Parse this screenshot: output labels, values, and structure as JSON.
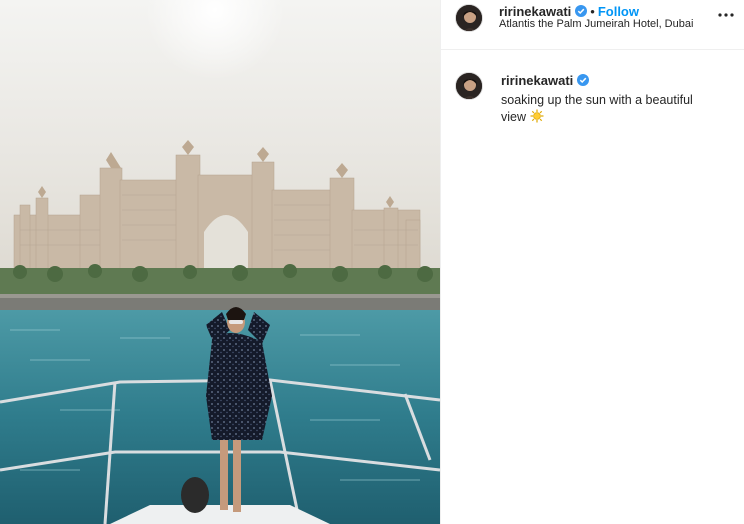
{
  "post": {
    "username": "ririnekawati",
    "follow_label": "Follow",
    "separator": "•",
    "location": "Atlantis the Palm Jumeirah Hotel, Dubai"
  },
  "caption": {
    "username": "ririnekawati",
    "text": "soaking up the sun with a beautiful view"
  },
  "icons": {
    "verified": "verified-badge-icon",
    "more": "more-options-icon",
    "sun": "sun-emoji-icon"
  },
  "colors": {
    "follow": "#0095f6",
    "verified": "#3897f0"
  }
}
